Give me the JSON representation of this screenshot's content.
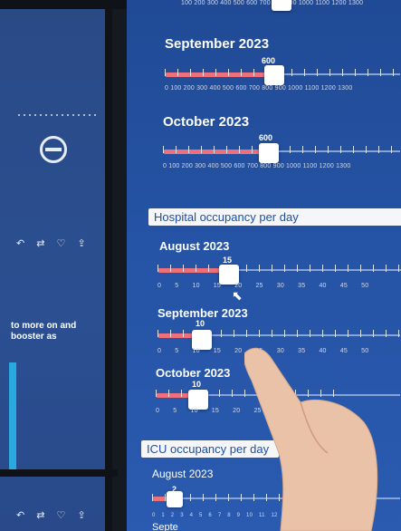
{
  "left_panel": {
    "text": "to more on and booster as",
    "icons_top": [
      "reply-icon",
      "retweet-icon",
      "heart-icon",
      "share-icon"
    ],
    "icons_bottom": [
      "reply-icon",
      "retweet-icon",
      "heart-icon",
      "share-icon"
    ]
  },
  "top_strip": {
    "scale": "100 200 300 400 500 600 700 800 900 1000 1100 1200 1300"
  },
  "vaccination": [
    {
      "month": "September 2023",
      "value": "600",
      "scale": "0 100 200 300 400 500 600 700 800 900 1000 1100 1200 1300"
    },
    {
      "month": "October 2023",
      "value": "600",
      "scale": "0 100 200 300 400 500 600 700 800 900 1000 1100 1200 1300"
    }
  ],
  "hospital": {
    "title": "Hospital occupancy per day",
    "rows": [
      {
        "month": "August 2023",
        "value": "15",
        "scale": "0 5 10 15 20 25 30 35 40 45 50"
      },
      {
        "month": "September 2023",
        "value": "10",
        "scale": "0 5 10 15 20 25 30 35 40 45 50"
      },
      {
        "month": "October 2023",
        "value": "10",
        "scale": "0 5 10 15 20 25 30"
      }
    ]
  },
  "icu": {
    "title": "ICU occupancy per day",
    "rows": [
      {
        "month": "August 2023",
        "value": "2",
        "scale": "0 1 2 3 4 5 6 7 8 9 10 11 12 13 14 15 16"
      },
      {
        "month": "Septe",
        "value": "",
        "scale": ""
      }
    ]
  }
}
